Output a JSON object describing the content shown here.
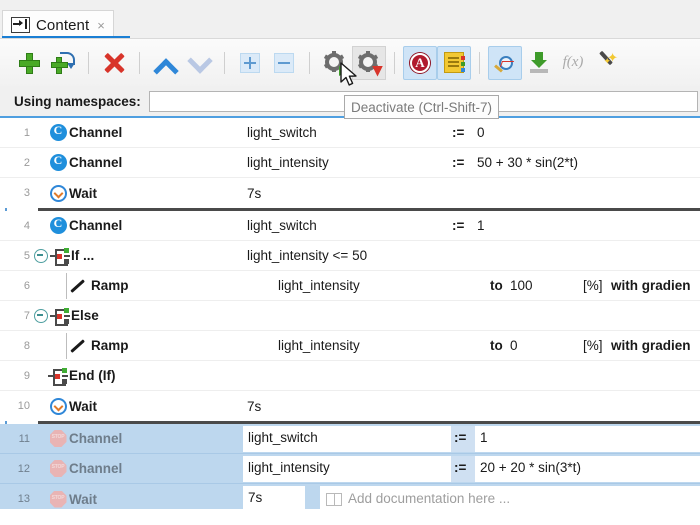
{
  "window": {
    "tab": {
      "title": "Content",
      "icon": "step-into-icon",
      "close": "×"
    }
  },
  "toolbar": {
    "buttons": [
      {
        "name": "add-step",
        "icon": "green-plus-icon",
        "tip": "Add",
        "state": "normal"
      },
      {
        "name": "insert-step",
        "icon": "green-plus-arrow-icon",
        "tip": "Insert",
        "state": "normal"
      },
      {
        "name": "delete-step",
        "icon": "red-x-icon",
        "tip": "Delete",
        "state": "normal"
      },
      {
        "name": "move-up",
        "icon": "chevron-up-icon",
        "tip": "Move Up",
        "state": "normal"
      },
      {
        "name": "move-down",
        "icon": "chevron-down-icon",
        "tip": "Move Down",
        "state": "disabled"
      },
      {
        "name": "expand-all",
        "icon": "box-plus-icon",
        "tip": "Expand All",
        "state": "disabled"
      },
      {
        "name": "collapse-all",
        "icon": "box-minus-icon",
        "tip": "Collapse All",
        "state": "disabled"
      },
      {
        "name": "activate",
        "icon": "gear-green-arrow-icon",
        "tip": "Activate",
        "state": "normal"
      },
      {
        "name": "deactivate",
        "icon": "gear-red-flag-icon",
        "tip": "Deactivate (Ctrl-Shift-7)",
        "state": "hover"
      },
      {
        "name": "annotation",
        "icon": "circle-a-icon",
        "tip": "Annotation",
        "state": "toggled"
      },
      {
        "name": "notebook",
        "icon": "notebook-icon",
        "tip": "Notebook",
        "state": "toggled"
      },
      {
        "name": "inspect-signal",
        "icon": "magnifier-pulse-icon",
        "tip": "Inspect",
        "state": "toggled"
      },
      {
        "name": "import",
        "icon": "download-arrow-icon",
        "tip": "Import",
        "state": "normal"
      },
      {
        "name": "function",
        "icon": "fx-icon",
        "tip": "Function",
        "state": "disabled"
      },
      {
        "name": "wizard",
        "icon": "magic-wand-icon",
        "tip": "Wizard",
        "state": "normal"
      }
    ]
  },
  "tooltip": {
    "text": "Deactivate (Ctrl-Shift-7)",
    "visible": true
  },
  "namespaces": {
    "label": "Using namespaces:",
    "value": "",
    "placeholder": ""
  },
  "sequence": {
    "rows": [
      {
        "num": "1",
        "icon": "channel-icon",
        "label": "Channel",
        "name": "light_switch",
        "assign": ":=",
        "value": "0",
        "selected": false,
        "thick_after": false,
        "indent": 0
      },
      {
        "num": "2",
        "icon": "channel-icon",
        "label": "Channel",
        "name": "light_intensity",
        "assign": ":=",
        "value": "50 + 30 * sin(2*t)",
        "selected": false,
        "thick_after": false,
        "indent": 0
      },
      {
        "num": "3",
        "icon": "wait-icon",
        "label": "Wait",
        "name": "7s",
        "assign": "",
        "value": "",
        "selected": false,
        "thick_after": true,
        "indent": 0
      },
      {
        "num": "4",
        "icon": "channel-icon",
        "label": "Channel",
        "name": "light_switch",
        "assign": ":=",
        "value": "1",
        "selected": false,
        "thick_after": false,
        "indent": 0
      },
      {
        "num": "5",
        "icon": "branch-icon",
        "label": "If ...",
        "name": "light_intensity <= 50",
        "assign": "",
        "value": "",
        "selected": false,
        "thick_after": false,
        "indent": 0,
        "expander": true
      },
      {
        "num": "6",
        "icon": "ramp-icon",
        "label": "Ramp",
        "name": "light_intensity",
        "assign": "",
        "value": "",
        "to_label": "to",
        "to_value": "100",
        "unit": "[%]",
        "gradient": "with gradien",
        "selected": false,
        "thick_after": false,
        "indent": 1
      },
      {
        "num": "7",
        "icon": "branch-icon",
        "label": "Else",
        "name": "",
        "assign": "",
        "value": "",
        "selected": false,
        "thick_after": false,
        "indent": 0,
        "expander": true
      },
      {
        "num": "8",
        "icon": "ramp-icon",
        "label": "Ramp",
        "name": "light_intensity",
        "assign": "",
        "value": "",
        "to_label": "to",
        "to_value": "0",
        "unit": "[%]",
        "gradient": "with gradien",
        "selected": false,
        "thick_after": false,
        "indent": 1
      },
      {
        "num": "9",
        "icon": "branch-icon",
        "label": "End (If)",
        "name": "",
        "assign": "",
        "value": "",
        "selected": false,
        "thick_after": false,
        "indent": 0
      },
      {
        "num": "10",
        "icon": "wait-icon",
        "label": "Wait",
        "name": "7s",
        "assign": "",
        "value": "",
        "selected": false,
        "thick_after": true,
        "indent": 0
      },
      {
        "num": "11",
        "icon": "stop-icon",
        "label": "Channel",
        "name": "light_switch",
        "assign": ":=",
        "value": "1",
        "selected": true,
        "editing": true,
        "thick_after": false,
        "indent": 0
      },
      {
        "num": "12",
        "icon": "stop-icon",
        "label": "Channel",
        "name": "light_intensity",
        "assign": ":=",
        "value": "20 + 20 * sin(3*t)",
        "selected": true,
        "editing": true,
        "thick_after": false,
        "indent": 0
      },
      {
        "num": "13",
        "icon": "stop-icon",
        "label": "Wait",
        "name": "7s",
        "assign": "",
        "value": "",
        "doc_placeholder": "Add documentation here ...",
        "selected": true,
        "editing": true,
        "thick_after": true,
        "indent": 0
      }
    ]
  },
  "colors": {
    "accent": "#1b7fd4",
    "selection": "#bdd7ee",
    "green": "#4aaa27",
    "red": "#d8342a",
    "channel_blue": "#1f8fdc"
  }
}
